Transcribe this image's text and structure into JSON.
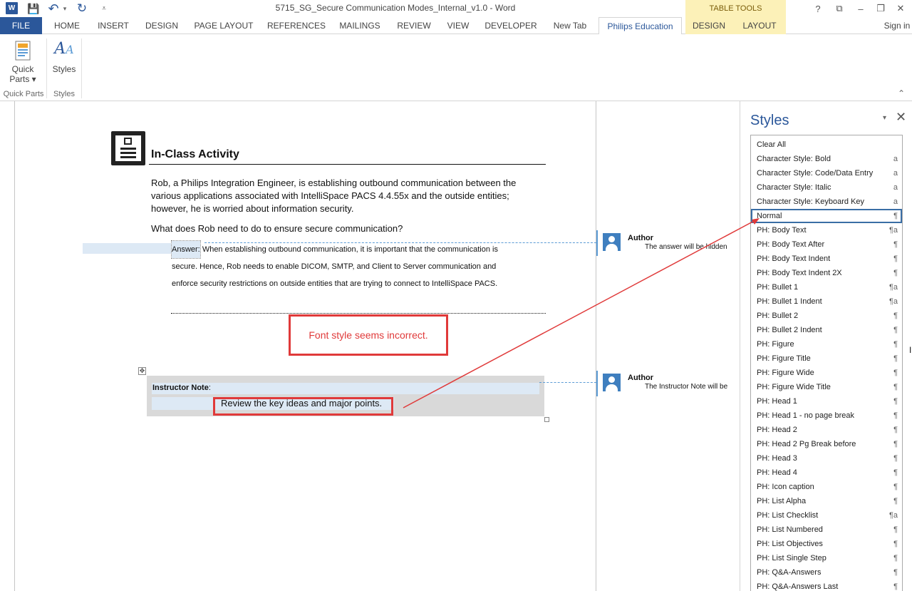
{
  "window": {
    "title": "5715_SG_Secure Communication Modes_Internal_v1.0 - Word",
    "contextual_header": "TABLE TOOLS",
    "sign_in": "Sign in"
  },
  "quick_access": {
    "logo": "W",
    "save_icon": "💾",
    "undo_icon": "↶",
    "undo_dd": "▾",
    "redo_icon": "↻",
    "customize_icon": "⩡"
  },
  "window_controls": {
    "help": "?",
    "ribbon_options": "⧉",
    "minimize": "–",
    "restore": "❐",
    "close": "✕"
  },
  "tabs": [
    "FILE",
    "HOME",
    "INSERT",
    "DESIGN",
    "PAGE LAYOUT",
    "REFERENCES",
    "MAILINGS",
    "REVIEW",
    "VIEW",
    "DEVELOPER",
    "New Tab",
    "Philips Education",
    "DESIGN",
    "LAYOUT"
  ],
  "ribbon": {
    "quick_parts_label": "Quick",
    "quick_parts_label2": "Parts ▾",
    "styles_label": "Styles",
    "group_quick_parts": "Quick Parts",
    "group_styles": "Styles",
    "collapse": "⌃"
  },
  "document": {
    "activity_title": "In-Class Activity",
    "intro_line1": "Rob, a Philips Integration Engineer, is establishing outbound communication between the",
    "intro_line2": "various applications associated with IntelliSpace PACS 4.4.55x and the outside entities;",
    "intro_line3": "however, he is worried about information security.",
    "question": "What does Rob need to do to ensure secure communication?",
    "answer_label": "Answer:",
    "answer_line1": "When establishing outbound communication, it is important that the communication is",
    "answer_line2": "secure. Hence, Rob needs to enable DICOM, SMTP, and Client to Server communication and",
    "answer_line3": "enforce security restrictions on outside entities that are trying to connect to IntelliSpace PACS.",
    "callout": "Font style seems incorrect.",
    "instructor_label": "Instructor Note",
    "instructor_colon": ":",
    "review_text": "Review the key ideas and major points.",
    "move_handle": "✥"
  },
  "comments": [
    {
      "author": "Author",
      "text": "The answer will be hidden,"
    },
    {
      "author": "Author",
      "text": "The Instructor Note will be"
    }
  ],
  "styles_pane": {
    "title": "Styles",
    "dropdown": "▾",
    "close": "✕",
    "items": [
      {
        "name": "Clear All",
        "mark": ""
      },
      {
        "name": "Character Style: Bold",
        "mark": "a"
      },
      {
        "name": "Character Style: Code/Data Entry",
        "mark": "a"
      },
      {
        "name": "Character Style: Italic",
        "mark": "a"
      },
      {
        "name": "Character Style: Keyboard Key",
        "mark": "a"
      },
      {
        "name": "Normal",
        "mark": "¶"
      },
      {
        "name": "PH: Body Text",
        "mark": "¶a"
      },
      {
        "name": "PH: Body Text After",
        "mark": "¶"
      },
      {
        "name": "PH: Body Text Indent",
        "mark": "¶"
      },
      {
        "name": "PH: Body Text Indent 2X",
        "mark": "¶"
      },
      {
        "name": "PH: Bullet 1",
        "mark": "¶a"
      },
      {
        "name": "PH: Bullet 1 Indent",
        "mark": "¶a"
      },
      {
        "name": "PH: Bullet 2",
        "mark": "¶"
      },
      {
        "name": "PH: Bullet 2 Indent",
        "mark": "¶"
      },
      {
        "name": "PH: Figure",
        "mark": "¶"
      },
      {
        "name": "PH: Figure Title",
        "mark": "¶"
      },
      {
        "name": "PH: Figure Wide",
        "mark": "¶"
      },
      {
        "name": "PH: Figure Wide Title",
        "mark": "¶"
      },
      {
        "name": "PH: Head 1",
        "mark": "¶"
      },
      {
        "name": "PH: Head 1 - no page break",
        "mark": "¶"
      },
      {
        "name": "PH: Head 2",
        "mark": "¶"
      },
      {
        "name": "PH: Head 2 Pg Break before",
        "mark": "¶"
      },
      {
        "name": "PH: Head 3",
        "mark": "¶"
      },
      {
        "name": "PH: Head 4",
        "mark": "¶"
      },
      {
        "name": "PH: Icon caption",
        "mark": "¶"
      },
      {
        "name": "PH: List Alpha",
        "mark": "¶"
      },
      {
        "name": "PH: List Checklist",
        "mark": "¶a"
      },
      {
        "name": "PH: List Numbered",
        "mark": "¶"
      },
      {
        "name": "PH: List Objectives",
        "mark": "¶"
      },
      {
        "name": "PH: List Single Step",
        "mark": "¶"
      },
      {
        "name": "PH: Q&A-Answers",
        "mark": "¶"
      },
      {
        "name": "PH: Q&A-Answers Last",
        "mark": "¶"
      }
    ]
  },
  "colors": {
    "accent": "#2b579a",
    "contextual": "#fcf1b8",
    "annotation": "#e03a3a",
    "comment": "#5b9bd5"
  }
}
